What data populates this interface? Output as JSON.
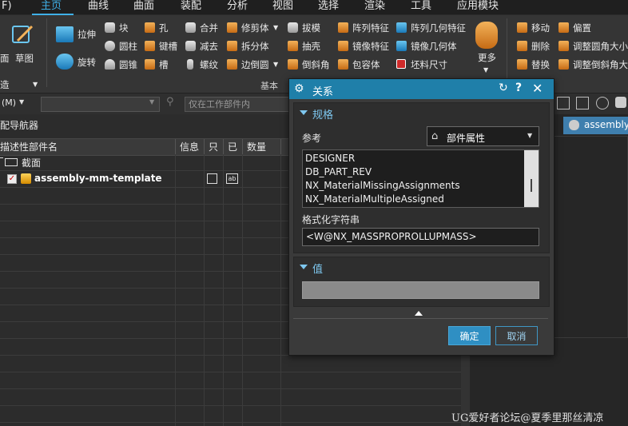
{
  "menubar": {
    "items": [
      "F)",
      "主页",
      "曲线",
      "曲面",
      "装配",
      "分析",
      "视图",
      "选择",
      "渲染",
      "工具",
      "应用模块"
    ],
    "active": "主页"
  },
  "ribbon": {
    "left_big": {
      "mian": "面",
      "sketch": "草图"
    },
    "extrude": "拉伸",
    "revolve": "旋转",
    "block": "块",
    "cylinder": "圆柱",
    "cone": "圆锥",
    "hole": "孔",
    "keyway": "键槽",
    "groove": "槽",
    "unite": "合并",
    "subtract": "减去",
    "thread": "螺纹",
    "trim_body": "修剪体",
    "split_body": "拆分体",
    "edge_blend": "边倒圆",
    "draft": "拔模",
    "shell": "抽壳",
    "chamfer": "倒斜角",
    "pattern_feature": "阵列特征",
    "mirror_feature": "镜像特征",
    "wrap": "包容体",
    "pattern_geometry": "阵列几何特征",
    "mirror_geometry": "镜像几何体",
    "stock_size": "坯料尺寸",
    "more": "更多",
    "move": "移动",
    "offset": "偏置",
    "delete": "删除",
    "resize_blend": "调整圆角大小",
    "replace": "替换",
    "resize_chamfer": "调整倒斜角大小",
    "group_basic": "基本",
    "group_left": "造"
  },
  "toolbar2": {
    "filter_label": "(M)",
    "combo_placeholder": "",
    "work_part_placeholder": "仅在工作部件内"
  },
  "navigator": {
    "title": "配导航器",
    "columns": [
      "描述性部件名",
      "信息",
      "只",
      "已",
      "数量"
    ],
    "rows": [
      {
        "name": "截面"
      },
      {
        "name": "assembly-mm-template"
      }
    ]
  },
  "graphics": {
    "tab_label": "assembly"
  },
  "dialog": {
    "title": "关系",
    "section_spec": "规格",
    "reference_label": "参考",
    "reference_value": "部件属性",
    "list": [
      "DESIGNER",
      "DB_PART_REV",
      "NX_MaterialMissingAssignments",
      "NX_MaterialMultipleAssigned"
    ],
    "format_label": "格式化字符串",
    "format_value": "<W@NX_MASSPROPROLLUPMASS>",
    "section_value": "值",
    "value_input": "",
    "ok": "确定",
    "cancel": "取消"
  },
  "watermark": "UG爱好者论坛@夏季里那丝清凉",
  "colors": {
    "accent": "#1f7fa9",
    "active_menu": "#3fb0e8",
    "section_header": "#7ec7ef"
  }
}
